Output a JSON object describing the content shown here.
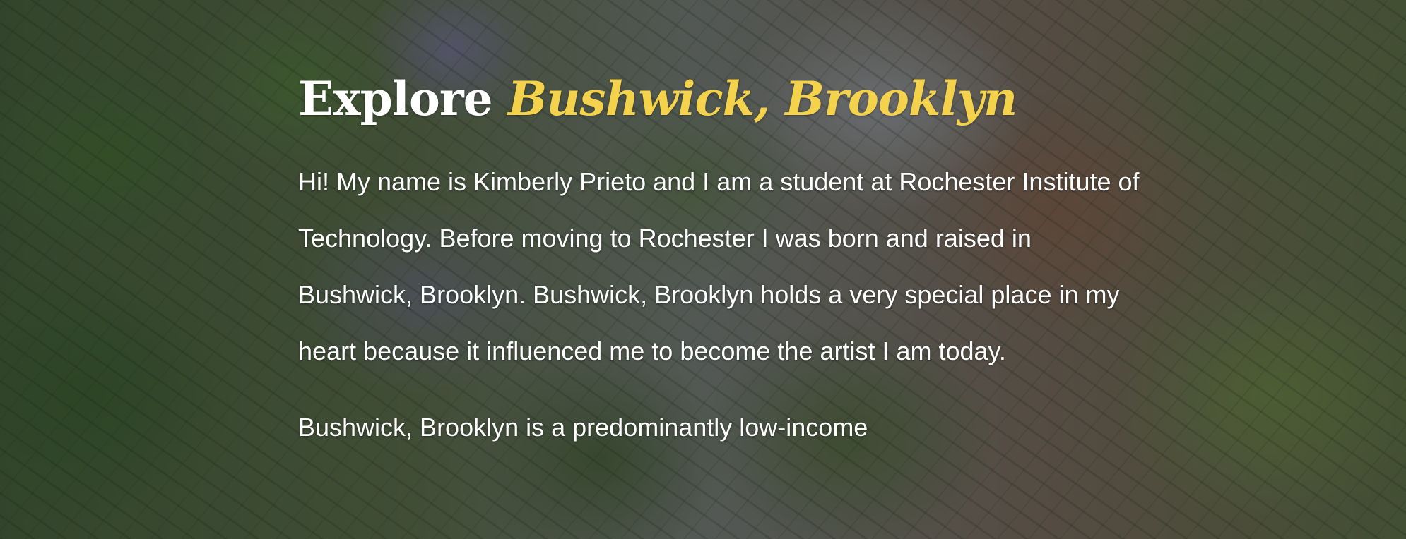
{
  "hero": {
    "title_prefix": "Explore ",
    "title_accent": "Bushwick, Brooklyn",
    "accent_color": "#f5d24b",
    "background_description_icon": "foliage-background-image"
  },
  "content": {
    "paragraphs": [
      "Hi! My name is Kimberly Prieto and I am a student at Rochester Institute of Technology. Before moving to Rochester I was born and raised in Bushwick, Brooklyn. Bushwick, Brooklyn holds a very special place in my heart because it influenced me to become the artist I am today.",
      "Bushwick, Brooklyn is a predominantly low-income"
    ]
  }
}
